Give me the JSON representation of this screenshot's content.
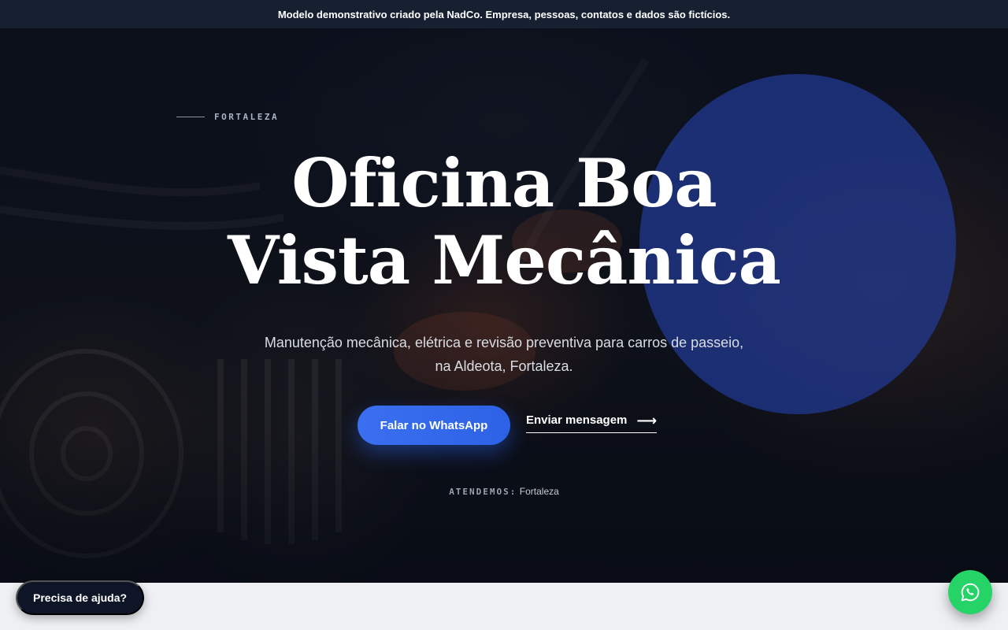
{
  "banner": {
    "text": "Modelo demonstrativo criado pela NadCo. Empresa, pessoas, contatos e dados são fictícios."
  },
  "hero": {
    "eyebrow": "FORTALEZA",
    "title_line1": "Oficina Boa",
    "title_line2": "Vista Mecânica",
    "subtitle_line1": "Manutenção mecânica, elétrica e revisão preventiva para carros de passeio,",
    "subtitle_line2": "na Aldeota, Fortaleza.",
    "primary_cta": "Falar no WhatsApp",
    "secondary_cta": "Enviar mensagem",
    "serves_label": "ATENDEMOS:",
    "serves_value": "Fortaleza"
  },
  "help": {
    "label": "Precisa de ajuda?"
  },
  "colors": {
    "accent": "#2d62e6",
    "whatsapp": "#25d366",
    "banner_bg": "#162030",
    "blob": "#213a96"
  },
  "icons": {
    "secondary_cta_icon": "arrow-right-icon",
    "fab_icon": "whatsapp-icon"
  }
}
